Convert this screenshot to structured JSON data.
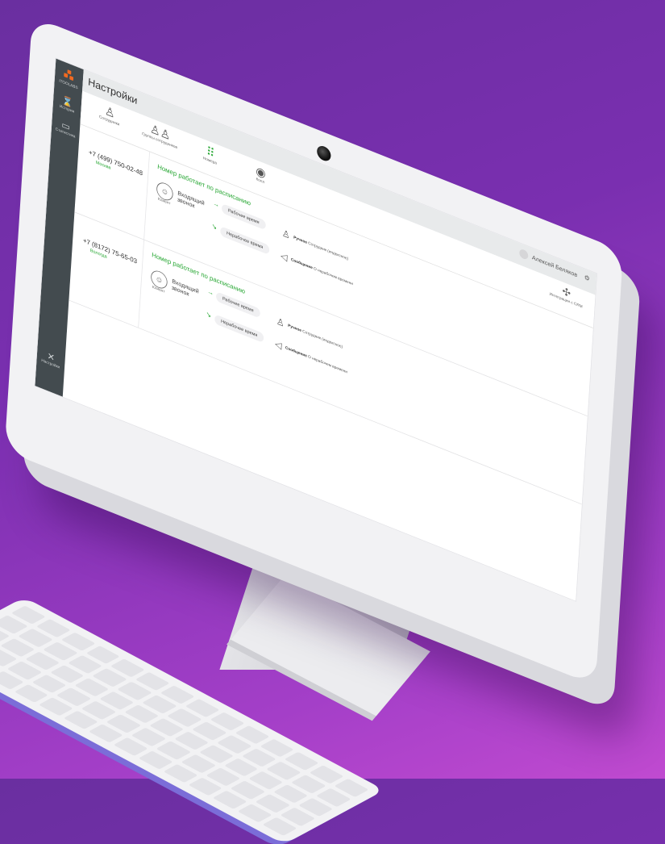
{
  "app": {
    "title": "Настройки"
  },
  "sidebar": {
    "logo": "ITOOLABS",
    "items": [
      {
        "label": "История",
        "icon": "hourglass-icon"
      },
      {
        "label": "Статистика",
        "icon": "chart-icon"
      }
    ],
    "settings": {
      "label": "Настройки",
      "icon": "tools-icon"
    }
  },
  "tabs": [
    {
      "label": "Сотрудники",
      "icon": "person-icon"
    },
    {
      "label": "Группы сотрудников",
      "icon": "group-icon"
    },
    {
      "label": "Номера",
      "icon": "keypad-icon",
      "active": true
    },
    {
      "label": "Колл",
      "icon": "phone-icon"
    }
  ],
  "user": {
    "name": "Алексей Беляков"
  },
  "integrations": {
    "label": "Интеграции с CRM",
    "icon": "puzzle-icon"
  },
  "numbers": [
    {
      "phone": "+7 (499) 750-02-48",
      "city": "Москва",
      "schedule": "Номер работает по расписанию",
      "client": "Клиент",
      "call": "Входящий звонок",
      "work_time": "Рабочее время",
      "off_time": "Нерабочее время",
      "target_work": "Ручное",
      "target_work_sub": "Сотрудник (индексное)",
      "target_off": "Сообщение",
      "target_off_sub": "О нерабочем времени"
    },
    {
      "phone": "+7 (8172) 75-65-03",
      "city": "Вологда",
      "schedule": "Номер работает по расписанию",
      "client": "Клиент",
      "call": "Входящий звонок",
      "work_time": "Рабочее время",
      "off_time": "Нерабочее время",
      "target_work": "Ручное",
      "target_work_sub": "Сотрудник (индексное)",
      "target_off": "Сообщение",
      "target_off_sub": "О нерабочем времени"
    }
  ],
  "colors": {
    "accent": "#2aa836",
    "sidebar": "#434b4f",
    "background_from": "#6a2fa0",
    "background_to": "#c04ad0"
  }
}
